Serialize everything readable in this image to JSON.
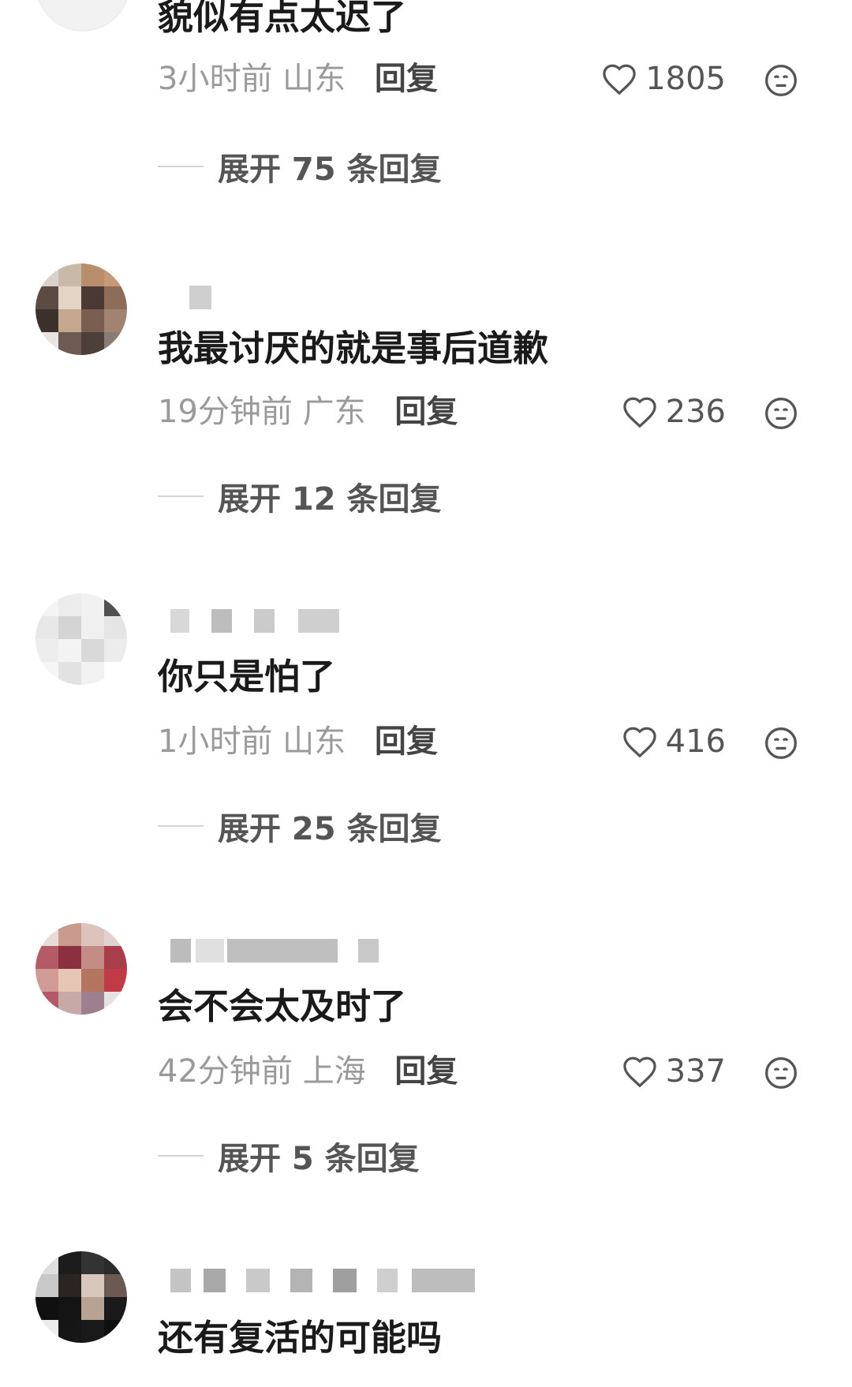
{
  "comments": [
    {
      "text": "貌似有点太迟了",
      "time": "3小时前",
      "region": "山东",
      "reply_label": "回复",
      "likes": "1805",
      "expand_label": "展开 75 条回复"
    },
    {
      "text": "我最讨厌的就是事后道歉",
      "time": "19分钟前",
      "region": "广东",
      "reply_label": "回复",
      "likes": "236",
      "expand_label": "展开 12 条回复"
    },
    {
      "text": "你只是怕了",
      "time": "1小时前",
      "region": "山东",
      "reply_label": "回复",
      "likes": "416",
      "expand_label": "展开 25 条回复"
    },
    {
      "text": "会不会太及时了",
      "time": "42分钟前",
      "region": "上海",
      "reply_label": "回复",
      "likes": "337",
      "expand_label": "展开 5 条回复"
    },
    {
      "text": "还有复活的可能吗"
    }
  ],
  "icons": {
    "like": "heart-outline-icon",
    "reaction": "neutral-face-icon"
  },
  "colors": {
    "text": "#1a1a1a",
    "meta": "#9a9a9a",
    "action": "#444444"
  }
}
